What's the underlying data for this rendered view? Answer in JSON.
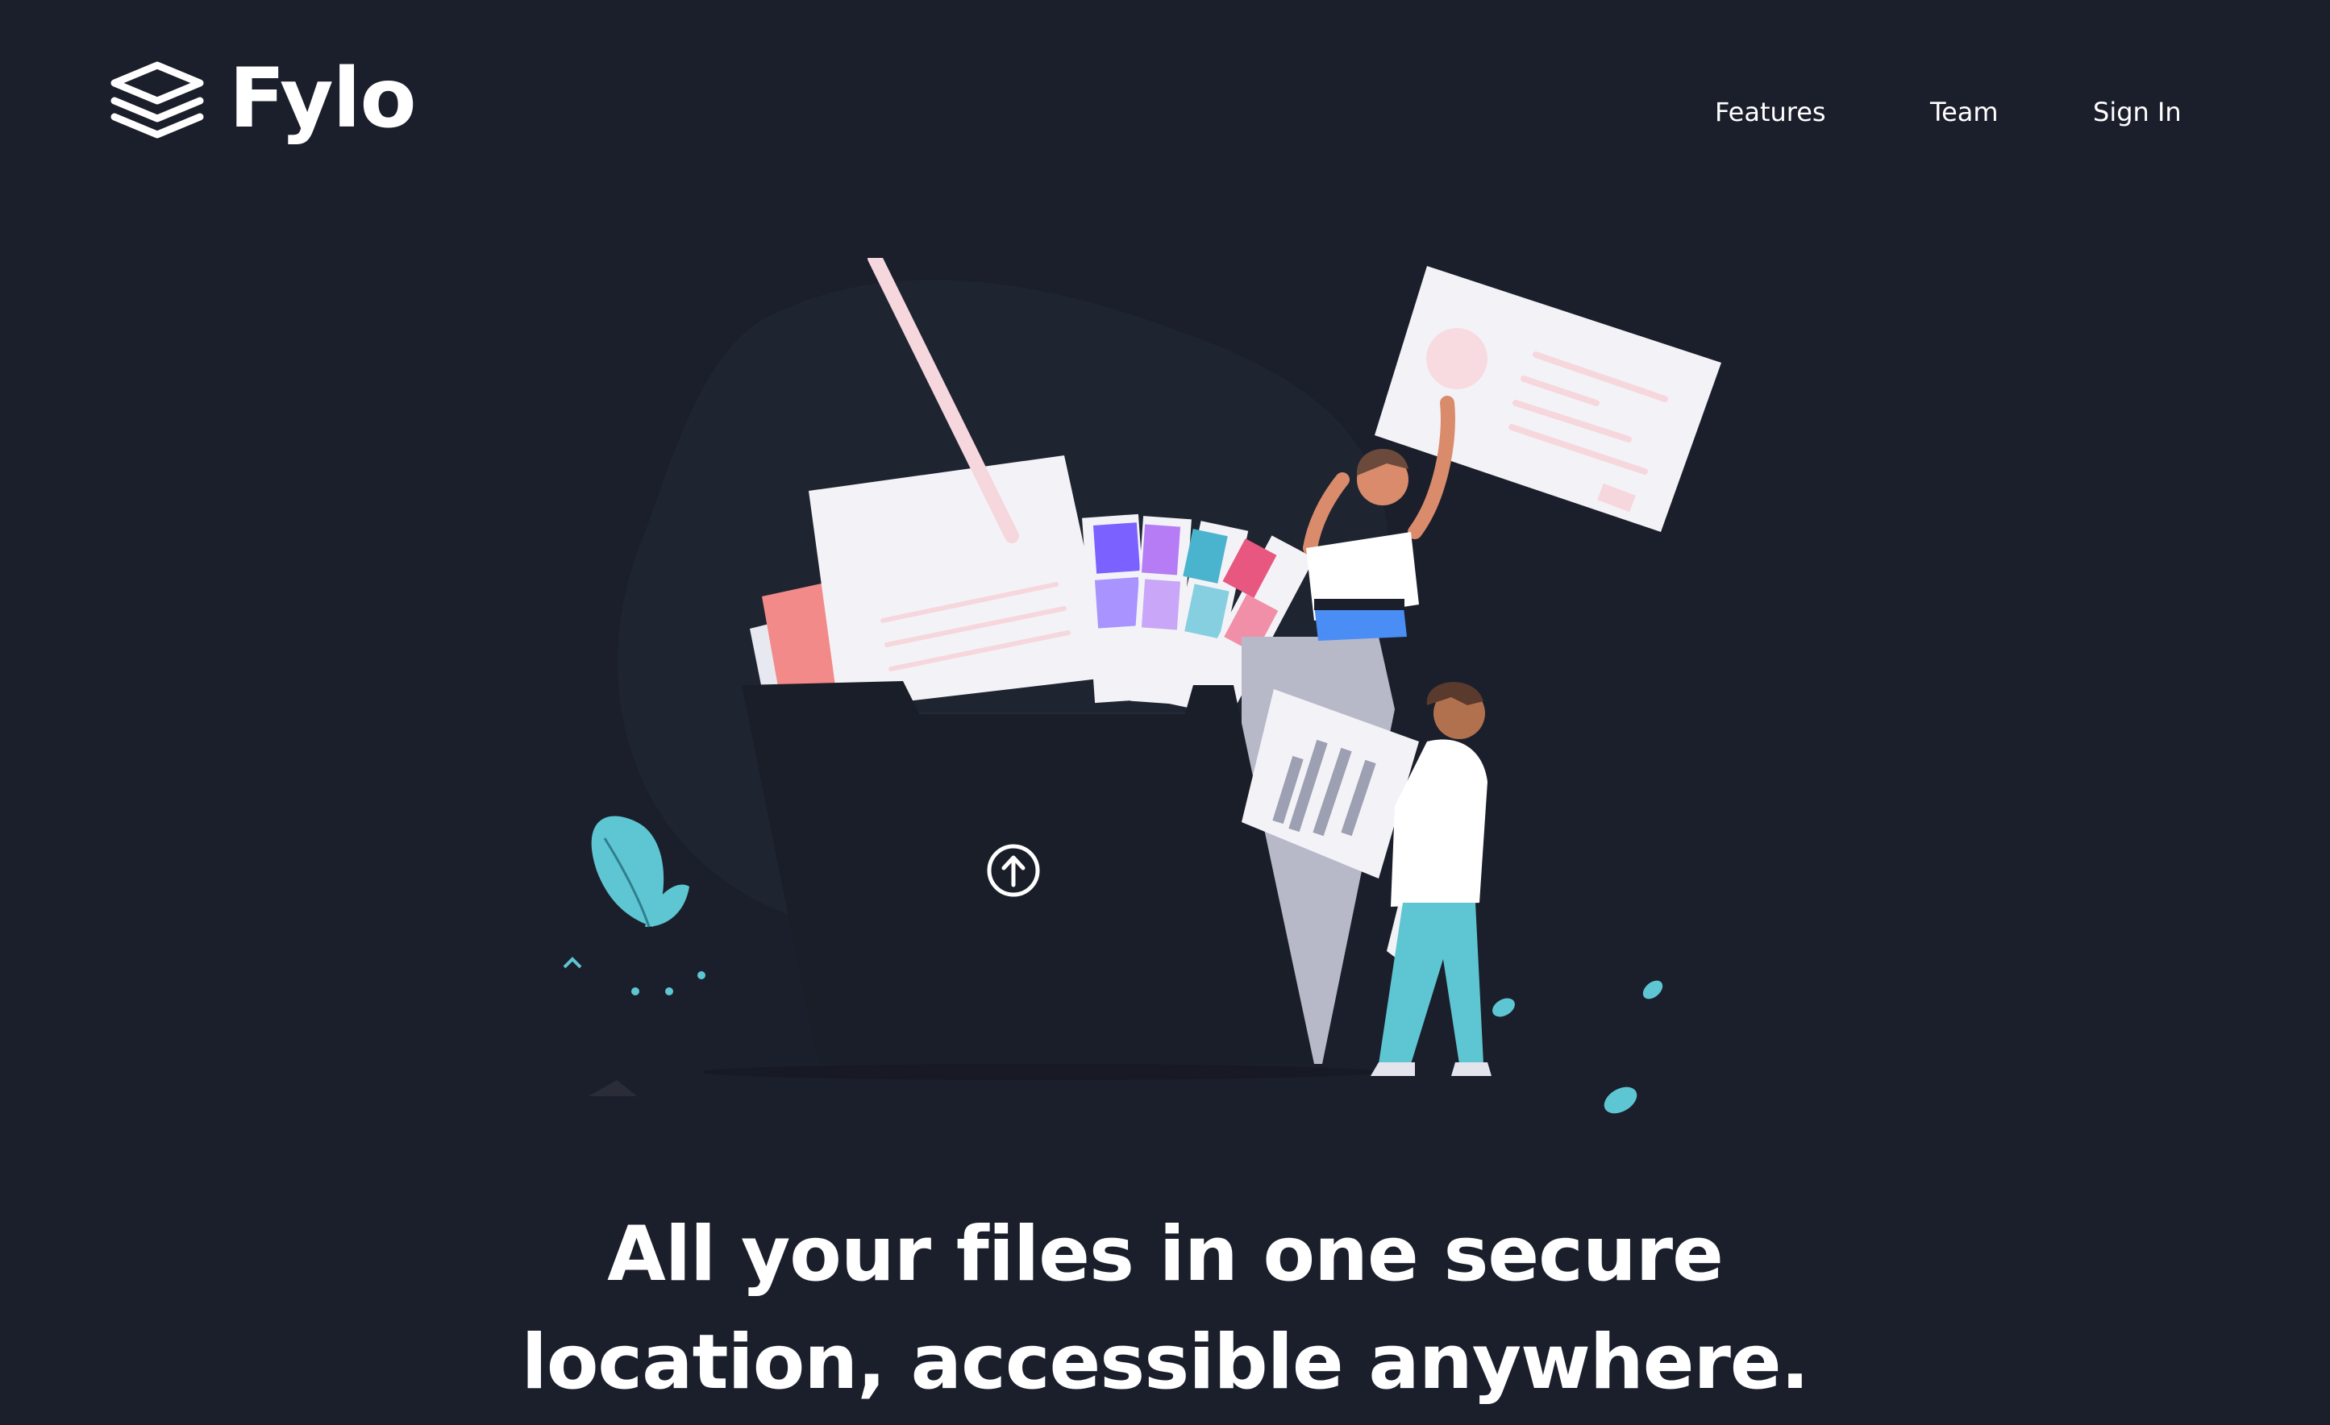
{
  "brand": {
    "name": "Fylo",
    "logo_icon": "stacked-layers-icon"
  },
  "nav": {
    "items": [
      {
        "label": "Features"
      },
      {
        "label": "Team"
      },
      {
        "label": "Sign In"
      }
    ]
  },
  "hero": {
    "illustration": "people-organizing-files-folder-illustration",
    "upload_icon": "upload-arrow-circle-icon",
    "headline_line1": "All your files in one secure",
    "headline_line2": "location, accessible anywhere."
  },
  "colors": {
    "background": "#1b1f2b",
    "text": "#ffffff",
    "accent_teal": "#5ec6d3",
    "folder_dark": "#1a1e29"
  }
}
